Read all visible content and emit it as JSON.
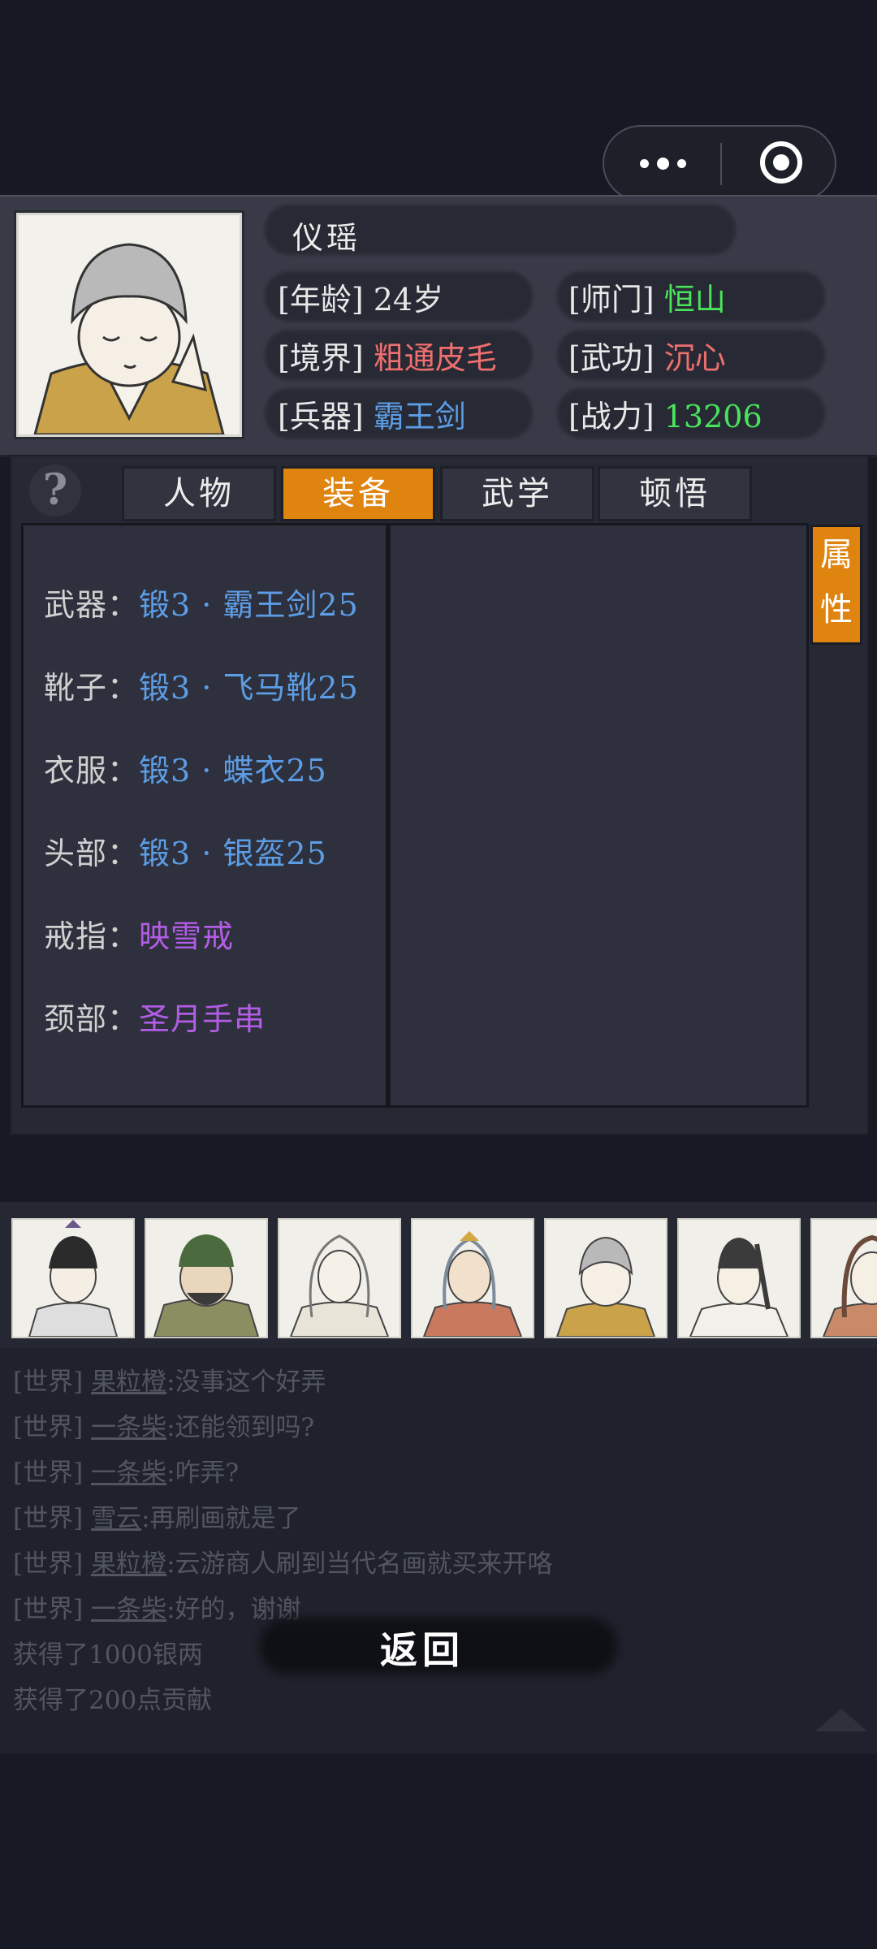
{
  "hero": {
    "name": "仪瑶",
    "age_label": "[年龄]",
    "age": "24岁",
    "sect_label": "[师门]",
    "sect": "恒山",
    "realm_label": "[境界]",
    "realm": "粗通皮毛",
    "skill_label": "[武功]",
    "skill": "沉心",
    "weapon_label": "[兵器]",
    "weapon": "霸王剑",
    "power_label": "[战力]",
    "power": "13206"
  },
  "help_icon": "?",
  "tabs": [
    "人物",
    "装备",
    "武学",
    "顿悟"
  ],
  "active_tab": "装备",
  "attr_button": [
    "属",
    "性"
  ],
  "equipment": [
    {
      "label": "武器：",
      "value": "锻3 · 霸王剑25",
      "color": "blue"
    },
    {
      "label": "靴子：",
      "value": "锻3 · 飞马靴25",
      "color": "blue"
    },
    {
      "label": "衣服：",
      "value": "锻3 · 蝶衣25",
      "color": "blue"
    },
    {
      "label": "头部：",
      "value": "锻3 · 银盔25",
      "color": "blue"
    },
    {
      "label": "戒指：",
      "value": "映雪戒",
      "color": "purple"
    },
    {
      "label": "颈部：",
      "value": "圣月手串",
      "color": "purple"
    }
  ],
  "chat": [
    {
      "channel": "[世界]",
      "user": "果粒橙",
      "msg": ":没事这个好弄"
    },
    {
      "channel": "[世界]",
      "user": "一条柴",
      "msg": ":还能领到吗?"
    },
    {
      "channel": "[世界]",
      "user": "一条柴",
      "msg": ":咋弄?"
    },
    {
      "channel": "[世界]",
      "user": "雪云",
      "msg": ":再刷画就是了"
    },
    {
      "channel": "[世界]",
      "user": "果粒橙",
      "msg": ":云游商人刷到当代名画就买来开咯"
    },
    {
      "channel": "[世界]",
      "user": "一条柴",
      "msg": ":好的，谢谢"
    }
  ],
  "rewards": [
    "获得了1000银两",
    "获得了200点贡献"
  ],
  "back_label": "返回",
  "colors": {
    "accent": "#e08410",
    "green": "#49e35c",
    "red": "#ef6f6f",
    "blue": "#5c9de6",
    "purple": "#b35ce6"
  }
}
